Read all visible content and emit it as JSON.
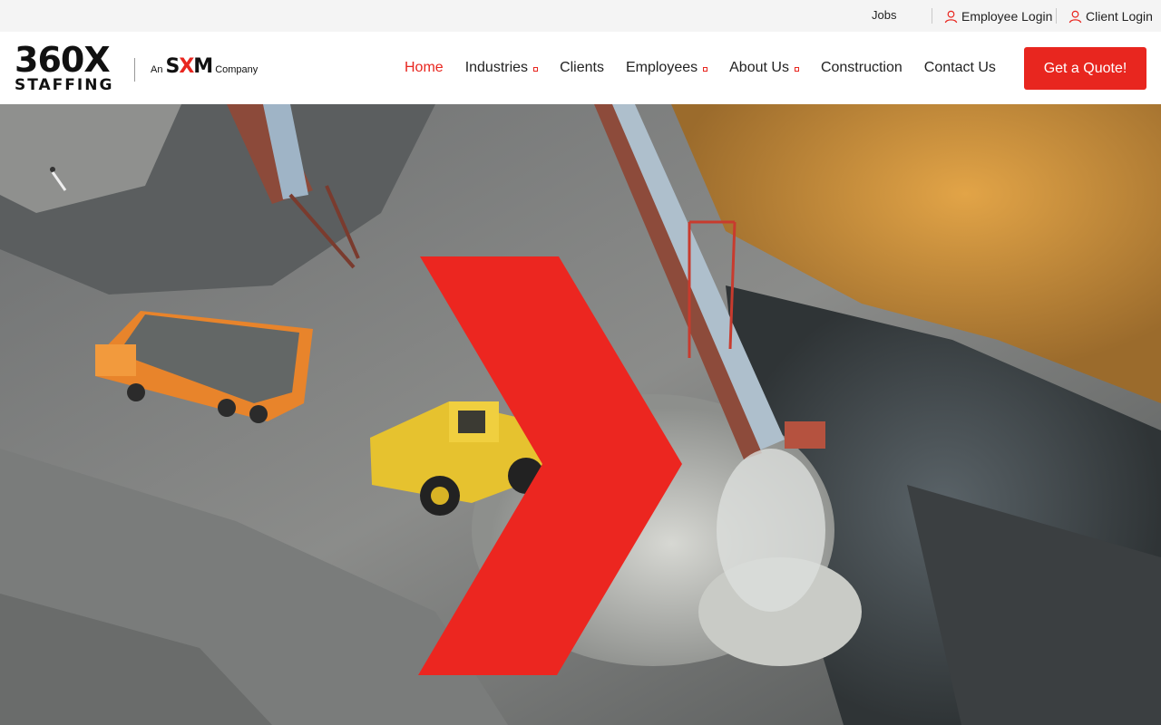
{
  "topbar": {
    "jobs_label": "Jobs",
    "employee_login_label": "Employee Login",
    "client_login_label": "Client Login"
  },
  "logo": {
    "number": "360",
    "x_letter": "X",
    "word": "STAFFING",
    "tag_prefix": "An",
    "tag_brand_a": "S",
    "tag_brand_b": "X",
    "tag_brand_c": "M",
    "tag_suffix": "Company"
  },
  "nav": {
    "items": [
      {
        "label": "Home",
        "active": true,
        "dropdown": false
      },
      {
        "label": "Industries",
        "active": false,
        "dropdown": true
      },
      {
        "label": "Clients",
        "active": false,
        "dropdown": false
      },
      {
        "label": "Employees",
        "active": false,
        "dropdown": true
      },
      {
        "label": "About Us",
        "active": false,
        "dropdown": true
      },
      {
        "label": "Construction",
        "active": false,
        "dropdown": false
      },
      {
        "label": "Contact Us",
        "active": false,
        "dropdown": false
      }
    ],
    "cta_label": "Get a Quote!"
  },
  "hero": {
    "icon": "chevron-right-icon",
    "accent_color": "#e8261f"
  },
  "colors": {
    "accent": "#e8261f",
    "topbar_bg": "#f4f4f4",
    "text": "#222222"
  }
}
